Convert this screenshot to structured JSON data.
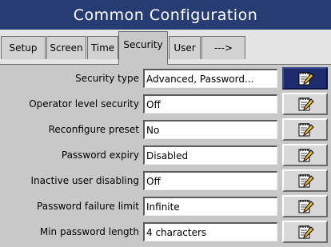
{
  "window": {
    "title": "Common Configuration"
  },
  "tabs": [
    {
      "label": "Setup",
      "active": false
    },
    {
      "label": "Screen",
      "active": false
    },
    {
      "label": "Time",
      "active": false
    },
    {
      "label": "Security",
      "active": true
    },
    {
      "label": "User",
      "active": false
    },
    {
      "label": "--->",
      "active": false
    }
  ],
  "fields": [
    {
      "label": "Security type",
      "value": "Advanced, Password..."
    },
    {
      "label": "Operator level security",
      "value": "Off"
    },
    {
      "label": "Reconfigure preset",
      "value": "No"
    },
    {
      "label": "Password expiry",
      "value": "Disabled"
    },
    {
      "label": "Inactive user disabling",
      "value": "Off"
    },
    {
      "label": "Password failure limit",
      "value": "Infinite"
    },
    {
      "label": "Min password length",
      "value": "4 characters"
    }
  ],
  "edit_icon": "notepad-pencil-icon",
  "colors": {
    "titlebar": "#283c74",
    "background": "#c8c8c8",
    "focused_button": "#1c2c6c"
  }
}
